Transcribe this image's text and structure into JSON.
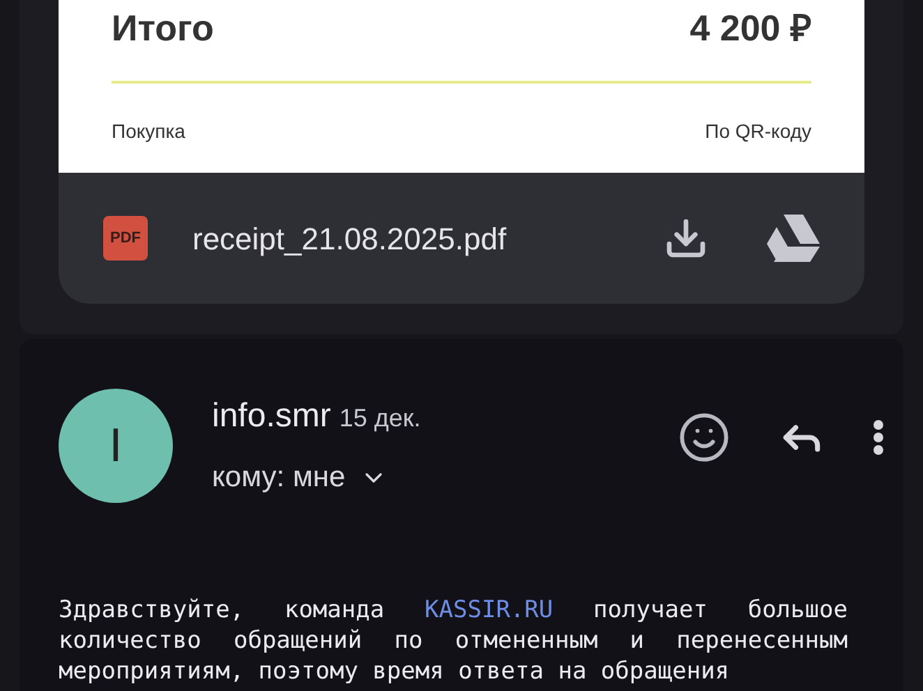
{
  "receipt": {
    "total_label": "Итого",
    "total_value": "4 200 ₽",
    "purchase_label": "Покупка",
    "payment_method": "По QR-коду"
  },
  "attachment": {
    "type_badge": "PDF",
    "file_name": "receipt_21.08.2025.pdf"
  },
  "message": {
    "avatar_letter": "I",
    "sender": "info.smr",
    "date": "15 дек.",
    "recipient": "кому: мне",
    "body_before": "Здравствуйте, команда",
    "body_link": "KASSIR.RU",
    "body_after": "получает большое количество обращений по отмененным и перенесенным мероприятиям, поэтому время ответа на обращения"
  }
}
